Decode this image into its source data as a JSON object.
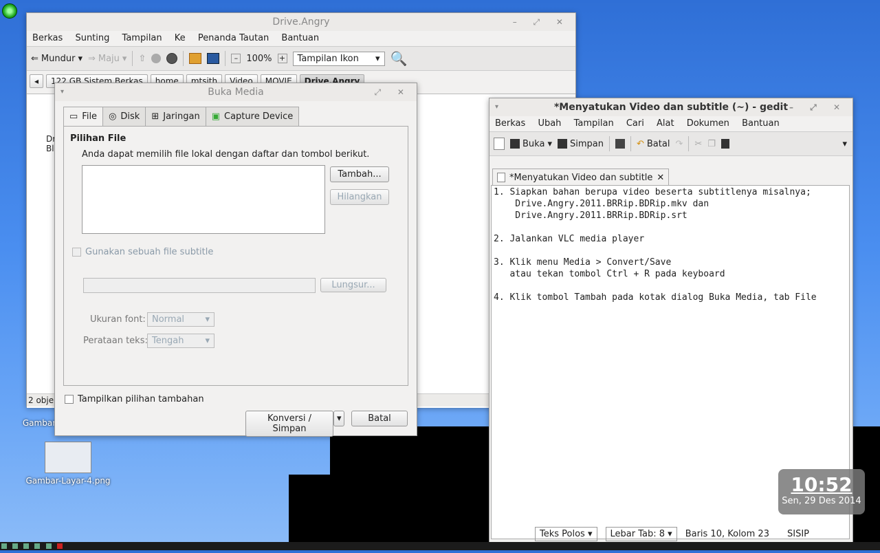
{
  "nautilus": {
    "title": "Drive.Angry",
    "menu": [
      "Berkas",
      "Sunting",
      "Tampilan",
      "Ke",
      "Penanda Tautan",
      "Bantuan"
    ],
    "back_label": "Mundur",
    "forward_label": "Maju",
    "zoom": "100%",
    "view_mode": "Tampilan Ikon",
    "crumbs": [
      "122 GB Sistem Berkas",
      "home",
      "mtsith",
      "Video",
      "MOVIE",
      "Drive.Angry"
    ],
    "status": "2 objek",
    "file_label_1": "Dr",
    "file_label_2": "Bl"
  },
  "dialog": {
    "title": "Buka Media",
    "tabs": [
      "File",
      "Disk",
      "Jaringan",
      "Capture Device"
    ],
    "section_title": "Pilihan File",
    "description": "Anda dapat memilih file lokal dengan daftar dan tombol berikut.",
    "add_button": "Tambah...",
    "remove_button": "Hilangkan",
    "subtitle_check": "Gunakan sebuah file subtitle",
    "browse_button": "Lungsur...",
    "font_size_label": "Ukuran font:",
    "font_size_value": "Normal",
    "align_label": "Perataan teks:",
    "align_value": "Tengah",
    "more_options": "Tampilkan pilihan tambahan",
    "convert_button": "Konversi / Simpan",
    "cancel_button": "Batal"
  },
  "gedit": {
    "title": "*Menyatukan Video dan subtitle (~) - gedit",
    "menu": [
      "Berkas",
      "Ubah",
      "Tampilan",
      "Cari",
      "Alat",
      "Dokumen",
      "Bantuan"
    ],
    "open_label": "Buka",
    "save_label": "Simpan",
    "undo_label": "Batal",
    "tab_label": "*Menyatukan Video dan subtitle",
    "lines": [
      "1. Siapkan bahan berupa video beserta subtitlenya misalnya;",
      "    Drive.Angry.2011.BRRip.BDRip.mkv dan",
      "    Drive.Angry.2011.BRRip.BDRip.srt",
      "",
      "2. Jalankan VLC media player",
      "",
      "3. Klik menu Media > Convert/Save",
      "   atau tekan tombol Ctrl + R pada keyboard",
      "",
      "4. Klik tombol Tambah pada kotak dialog Buka Media, tab File"
    ],
    "status_lang": "Teks Polos",
    "status_tab": "Lebar Tab:  8",
    "status_pos": "Baris 10, Kolom 23",
    "status_mode": "SISIP"
  },
  "desktop": {
    "icon1_label": "Gambar",
    "icon2_label": "Gambar-Layar-4.png"
  },
  "clock": {
    "time": "10:52",
    "date": "Sen, 29 Des 2014"
  }
}
